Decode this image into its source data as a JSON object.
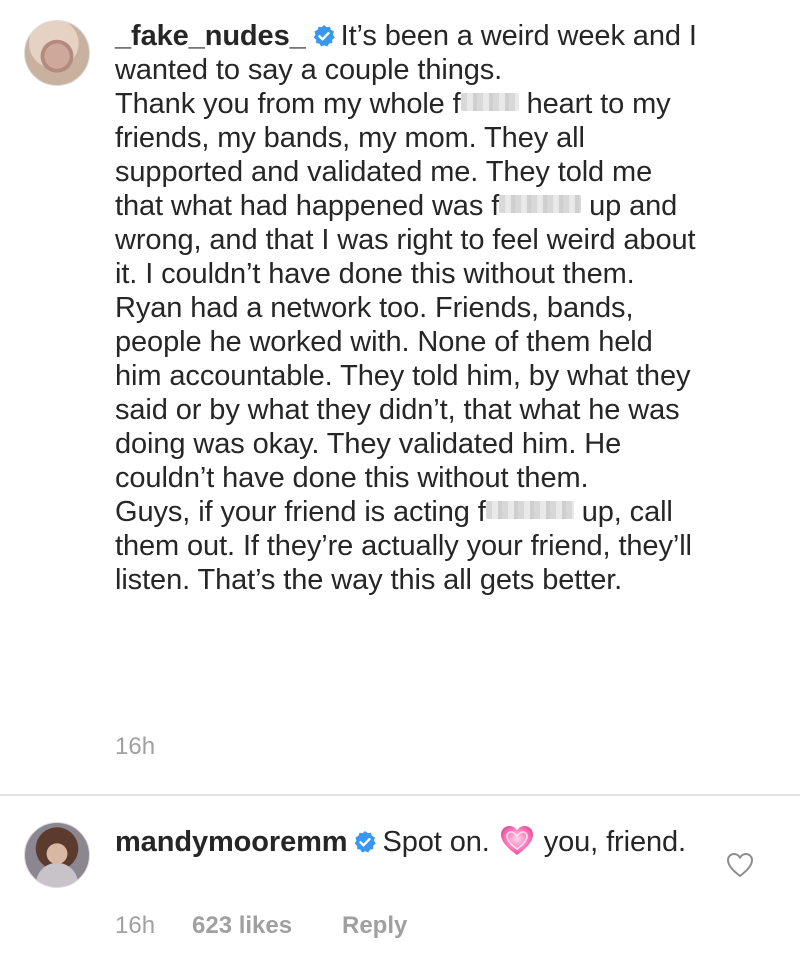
{
  "comments": [
    {
      "username": "_fake_nudes_",
      "verified": true,
      "paragraphs": [
        {
          "segments": [
            {
              "t": "It’s been a weird week and I wanted to say a couple things."
            }
          ]
        },
        {
          "segments": [
            {
              "t": "Thank you from my whole f"
            },
            {
              "censored": true
            },
            {
              "t": " heart to my friends, my bands, my mom. They all supported and validated me. They told me that what had happened was f"
            },
            {
              "censored": true
            },
            {
              "t": " up and wrong, and that I was right to feel weird about it. I couldn’t have done this without them."
            }
          ]
        },
        {
          "segments": [
            {
              "t": "Ryan had a network too. Friends, bands, people he worked with. None of them held him accountable. They told him, by what they said or by what they didn’t, that what he was doing was okay. They validated him. He couldn’t have done this without them."
            }
          ]
        },
        {
          "segments": [
            {
              "t": "Guys, if your friend is acting f"
            },
            {
              "censored": true
            },
            {
              "t": " up, call them out. If they’re actually your friend, they’ll listen. That’s the way this all gets better."
            }
          ]
        }
      ],
      "time": "16h"
    },
    {
      "username": "mandymooremm",
      "verified": true,
      "text_before_emoji": "Spot on.",
      "emoji": "pink-heart-emoji",
      "text_after_emoji": "you, friend.",
      "time": "16h",
      "likes": "623 likes",
      "reply_label": "Reply"
    }
  ],
  "colors": {
    "text": "#262626",
    "meta": "#a0a0a0",
    "verified": "#3897f0",
    "divider": "#e2e2e2"
  }
}
